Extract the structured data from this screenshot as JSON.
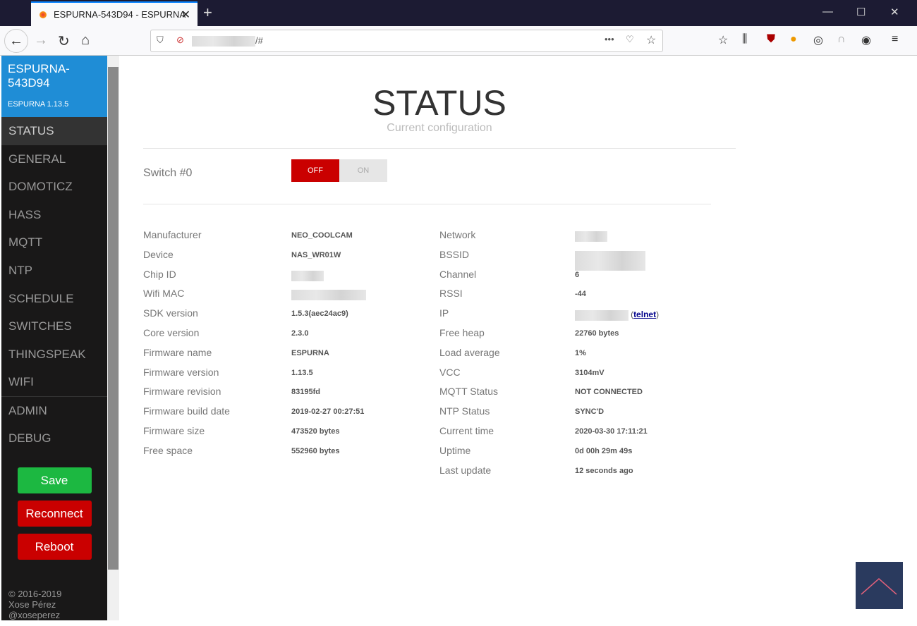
{
  "browser": {
    "tab_title": "ESPURNA-543D94 - ESPURNA",
    "url_suffix": "/#"
  },
  "sidebar": {
    "device_name": "ESPURNA-543D94",
    "version": "ESPURNA 1.13.5",
    "items": [
      "STATUS",
      "GENERAL",
      "DOMOTICZ",
      "HASS",
      "MQTT",
      "NTP",
      "SCHEDULE",
      "SWITCHES",
      "THINGSPEAK",
      "WIFI",
      "ADMIN",
      "DEBUG"
    ],
    "selected": "STATUS",
    "save": "Save",
    "reconnect": "Reconnect",
    "reboot": "Reboot",
    "copyright": [
      "© 2016-2019",
      "Xose Pérez",
      "@xoseperez"
    ]
  },
  "colors": {
    "brand": "#1f8dd6",
    "save": "#1cb841",
    "danger": "#ca0000"
  },
  "main": {
    "title": "STATUS",
    "subtitle": "Current configuration",
    "switch": {
      "label": "Switch #0",
      "off": "OFF",
      "on": "ON",
      "state": "off"
    },
    "left": [
      [
        "Manufacturer",
        "NEO_COOLCAM"
      ],
      [
        "Device",
        "NAS_WR01W"
      ],
      [
        "Chip ID",
        null
      ],
      [
        "Wifi MAC",
        null
      ],
      [
        "SDK version",
        "1.5.3(aec24ac9)"
      ],
      [
        "Core version",
        "2.3.0"
      ],
      [
        "Firmware name",
        "ESPURNA"
      ],
      [
        "Firmware version",
        "1.13.5"
      ],
      [
        "Firmware revision",
        "83195fd"
      ],
      [
        "Firmware build date",
        "2019-02-27 00:27:51"
      ],
      [
        "Firmware size",
        "473520 bytes"
      ],
      [
        "Free space",
        "552960 bytes"
      ]
    ],
    "right": [
      [
        "Network",
        null
      ],
      [
        "BSSID",
        null
      ],
      [
        "Channel",
        "6"
      ],
      [
        "RSSI",
        "-44"
      ],
      [
        "IP",
        null
      ],
      [
        "Free heap",
        "22760 bytes"
      ],
      [
        "Load average",
        "1%"
      ],
      [
        "VCC",
        "3104mV"
      ],
      [
        "MQTT Status",
        "NOT CONNECTED"
      ],
      [
        "NTP Status",
        "SYNC'D"
      ],
      [
        "Current time",
        "2020-03-30 17:11:21"
      ],
      [
        "Uptime",
        "0d 00h 29m 49s"
      ],
      [
        "Last update",
        "12 seconds ago"
      ]
    ],
    "telnet": "telnet"
  }
}
